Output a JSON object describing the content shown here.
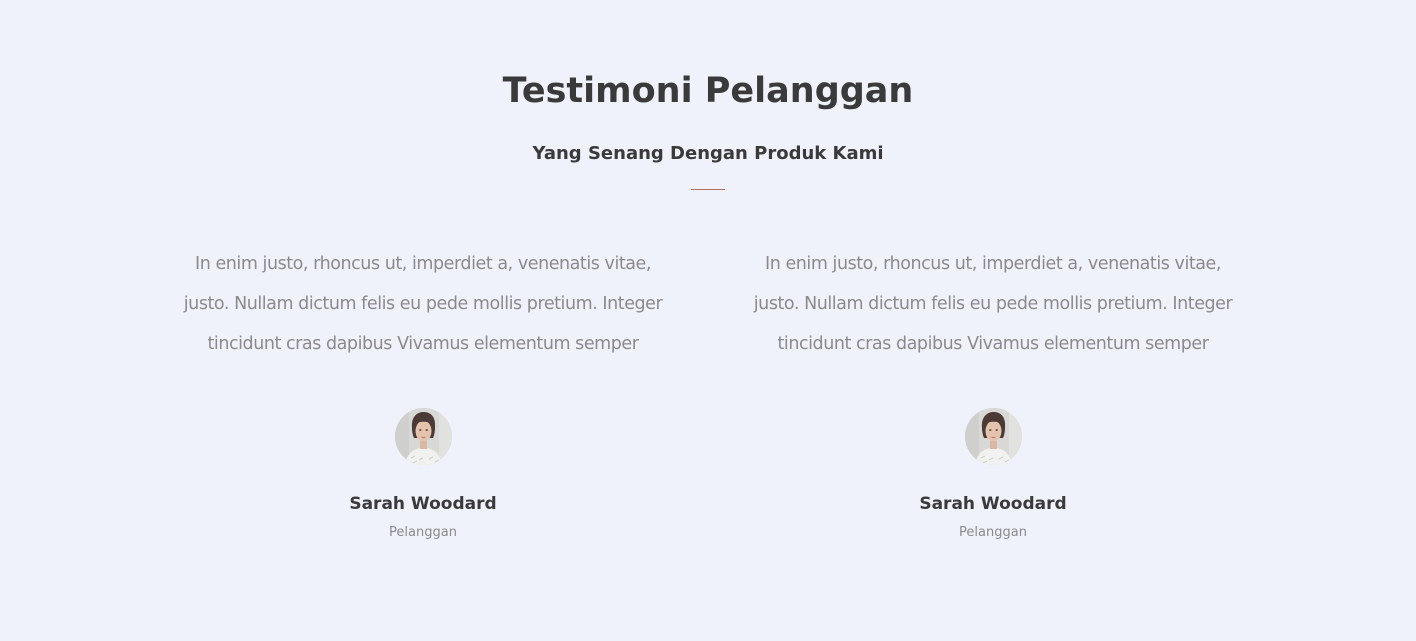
{
  "header": {
    "title": "Testimoni Pelanggan",
    "subtitle": "Yang Senang Dengan Produk Kami"
  },
  "colors": {
    "background": "#f0f2fb",
    "heading": "#3a3a3a",
    "body_text": "#8a8a8a",
    "divider": "#b5705d"
  },
  "testimonials": [
    {
      "quote_lines": [
        "In enim justo, rhoncus ut, imperdiet a, venenatis vitae,",
        "justo. Nullam dictum felis eu pede mollis pretium. Integer",
        "tincidunt cras dapibus Vivamus elementum semper"
      ],
      "avatar_icon": "woman-portrait-avatar",
      "name": "Sarah Woodard",
      "role": "Pelanggan"
    },
    {
      "quote_lines": [
        "In enim justo, rhoncus ut, imperdiet a, venenatis vitae,",
        "justo. Nullam dictum felis eu pede mollis pretium. Integer",
        "tincidunt cras dapibus Vivamus elementum semper"
      ],
      "avatar_icon": "woman-portrait-avatar",
      "name": "Sarah Woodard",
      "role": "Pelanggan"
    }
  ]
}
